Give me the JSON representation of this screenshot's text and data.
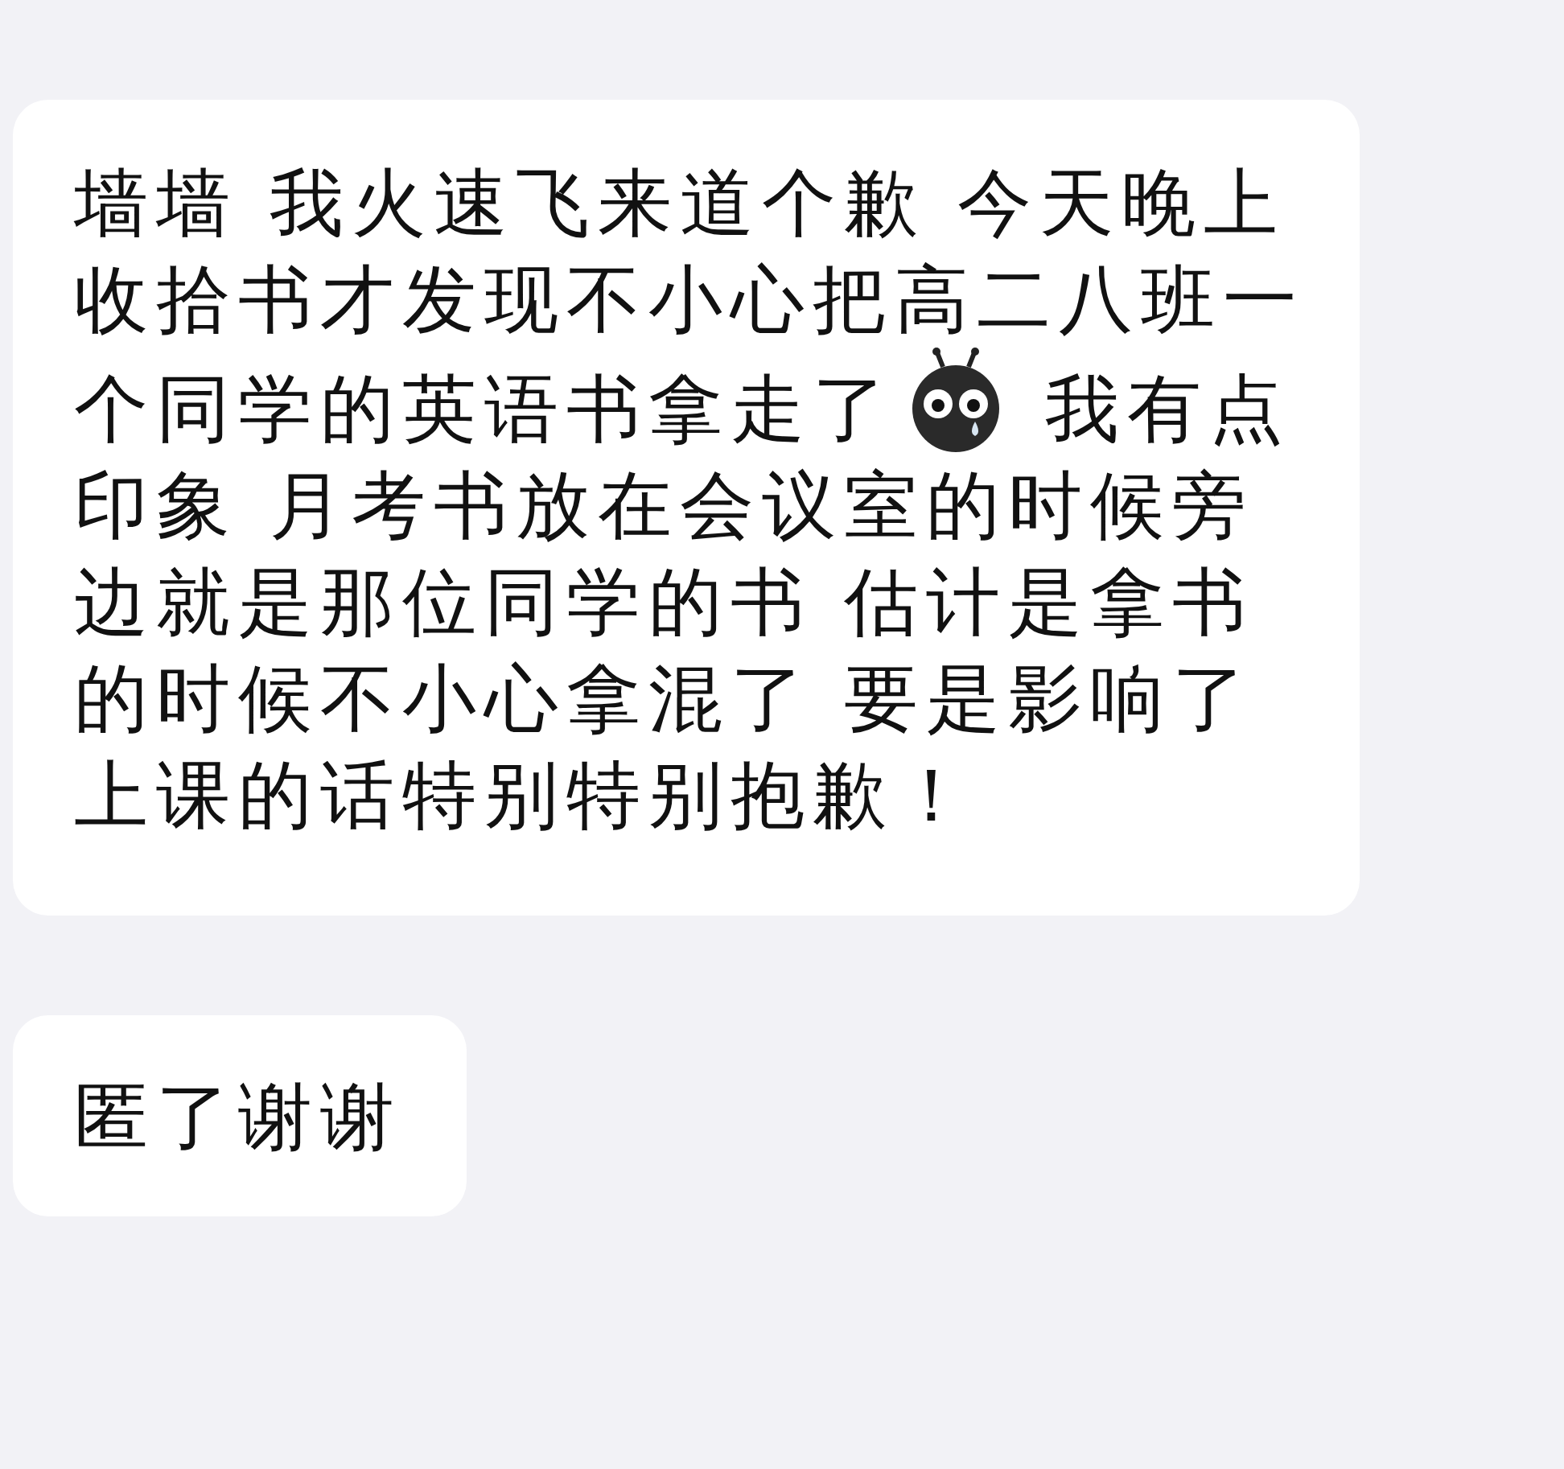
{
  "messages": [
    {
      "lines": [
        [
          {
            "kind": "text",
            "text": "墙墙 我火速飞来道个歉 今天晚上"
          }
        ],
        [
          {
            "kind": "text",
            "text": "收拾书才发现不小心把高二八班一"
          }
        ],
        [
          {
            "kind": "text",
            "text": "个同学的英语书拿走了"
          },
          {
            "kind": "sticker"
          },
          {
            "kind": "text",
            "text": " 我有点"
          }
        ],
        [
          {
            "kind": "text",
            "text": "印象 月考书放在会议室的时候旁"
          }
        ],
        [
          {
            "kind": "text",
            "text": "边就是那位同学的书 估计是拿书"
          }
        ],
        [
          {
            "kind": "text",
            "text": "的时候不小心拿混了 要是影响了"
          }
        ],
        [
          {
            "kind": "text",
            "text": "上课的话特别特别抱歉！"
          }
        ]
      ]
    },
    {
      "lines": [
        [
          {
            "kind": "text",
            "text": "匿了谢谢"
          }
        ]
      ]
    }
  ]
}
